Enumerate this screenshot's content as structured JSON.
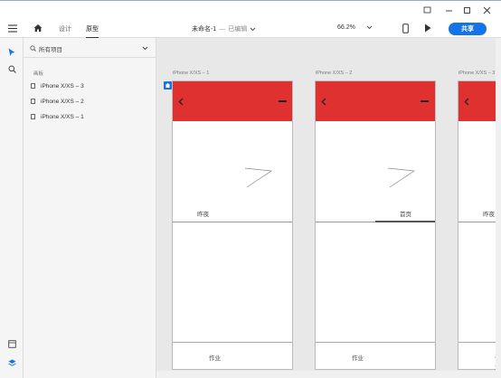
{
  "toolbar": {
    "tabs": [
      "设计",
      "原型"
    ],
    "doc_title": "未命名-1",
    "doc_separator": "—",
    "doc_status": "已编辑",
    "zoom": "66.2%",
    "share_label": "共享"
  },
  "panel": {
    "search_placeholder": "所有项目",
    "section_label": "画板",
    "items": [
      "iPhone X/XS – 3",
      "iPhone X/XS – 2",
      "iPhone X/XS – 1"
    ]
  },
  "artboards": [
    {
      "label": "iPhone X/XS – 1",
      "tab_label": "昨夜",
      "bottom_label": "作业"
    },
    {
      "label": "iPhone X/XS – 2",
      "tab_label": "首页",
      "bottom_label": "作业"
    },
    {
      "label": "iPhone X/XS – 3",
      "tab_label": "昨夜",
      "bottom_label": "作业"
    }
  ],
  "colors": {
    "accent": "#1473e6",
    "header_red": "#e03131"
  }
}
